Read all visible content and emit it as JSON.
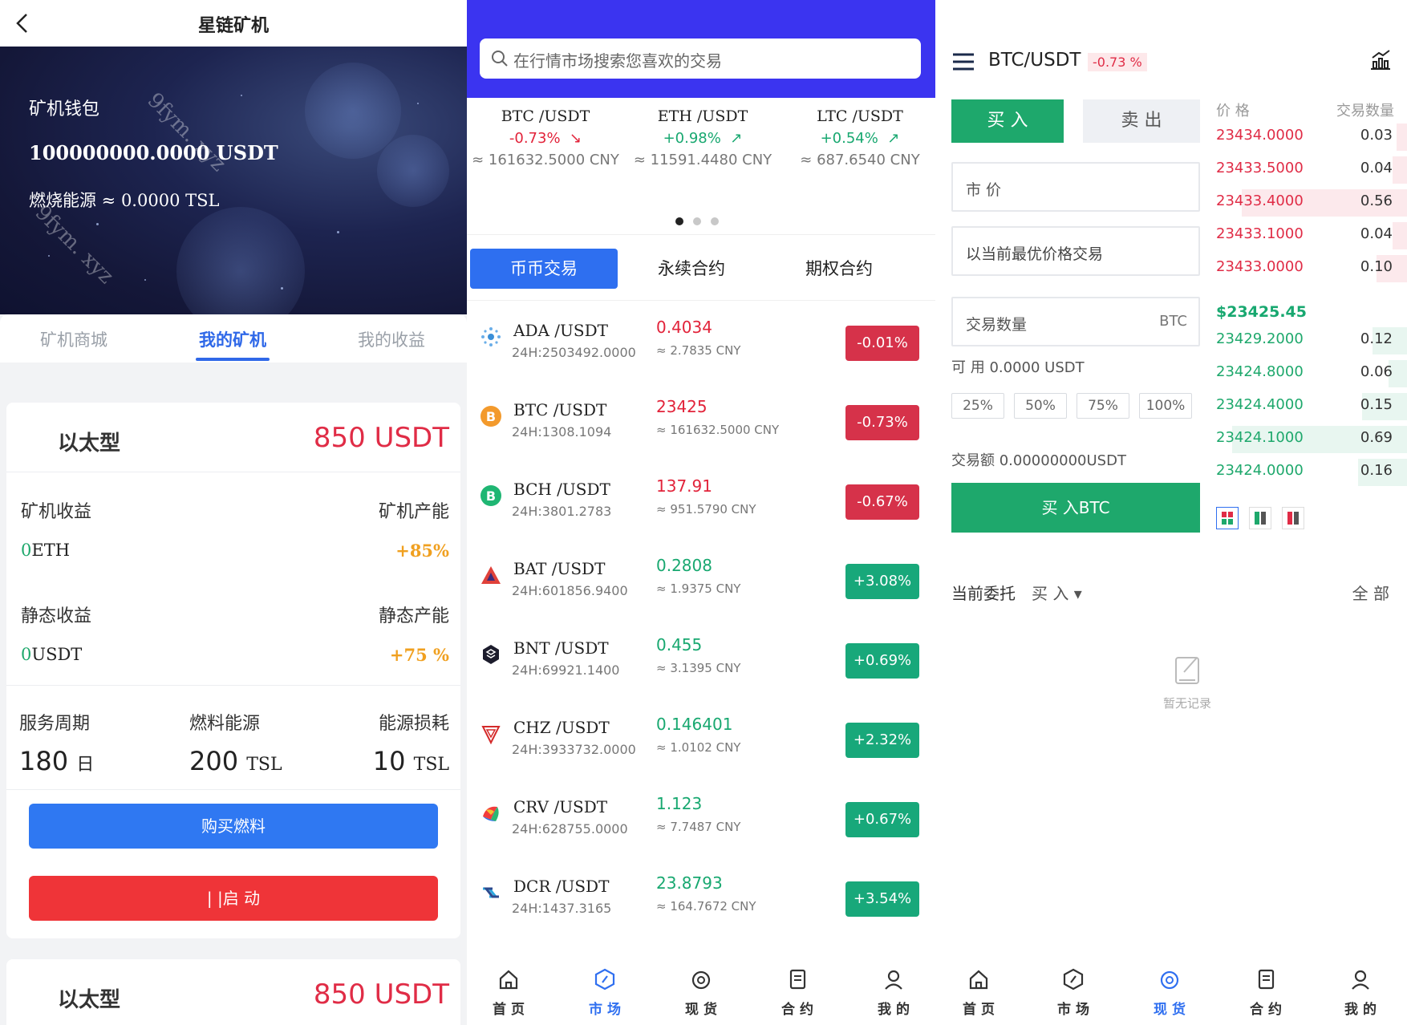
{
  "mining": {
    "title": "星链矿机",
    "banner": {
      "wallet_label": "矿机钱包",
      "balance": "100000000.0000 USDT",
      "fuel": "燃烧能源 ≈ 0.0000 TSL"
    },
    "tabs": [
      {
        "label": "矿机商城"
      },
      {
        "label": "我的矿机"
      },
      {
        "label": "我的收益"
      }
    ],
    "card": {
      "type": "以太型",
      "price": "850 USDT",
      "machine_income_label": "矿机收益",
      "machine_capacity_label": "矿机产能",
      "machine_income_num": "0",
      "machine_income_unit": "ETH",
      "machine_capacity": "+85%",
      "static_income_label": "静态收益",
      "static_capacity_label": "静态产能",
      "static_income_num": "0",
      "static_income_unit": "USDT",
      "static_capacity": "+75 %",
      "period_label": "服务周期",
      "fuel_label": "燃料能源",
      "loss_label": "能源损耗",
      "period_value": "180",
      "period_unit": "日",
      "fuel_value": "200",
      "fuel_unit": "TSL",
      "loss_value": "10",
      "loss_unit": "TSL",
      "buy_fuel": "购买燃料",
      "start": "| |启 动"
    },
    "card2": {
      "type": "以太型",
      "price": "850 USDT"
    },
    "watermark": "9fym. xyz"
  },
  "market": {
    "search_placeholder": "在行情市场搜索您喜欢的交易",
    "tickers": [
      {
        "pair": "BTC /USDT",
        "change": "-0.73%",
        "arrow": "↘",
        "cny": "≈ 161632.5000 CNY",
        "dir": "neg"
      },
      {
        "pair": "ETH /USDT",
        "change": "+0.98%",
        "arrow": "↗",
        "cny": "≈ 11591.4480 CNY",
        "dir": "pos"
      },
      {
        "pair": "LTC /USDT",
        "change": "+0.54%",
        "arrow": "↗",
        "cny": "≈ 687.6540 CNY",
        "dir": "pos"
      }
    ],
    "tabs": [
      {
        "label": "币币交易"
      },
      {
        "label": "永续合约"
      },
      {
        "label": "期权合约"
      }
    ],
    "rows": [
      {
        "icon": "ada-icon",
        "pair": "ADA /USDT",
        "vol": "24H:2503492.0000",
        "price": "0.4034",
        "cny": "≈ 2.7835 CNY",
        "change": "-0.01%",
        "dir": "neg"
      },
      {
        "icon": "btc-icon",
        "pair": "BTC /USDT",
        "vol": "24H:1308.1094",
        "price": "23425",
        "cny": "≈ 161632.5000 CNY",
        "change": "-0.73%",
        "dir": "neg"
      },
      {
        "icon": "bch-icon",
        "pair": "BCH /USDT",
        "vol": "24H:3801.2783",
        "price": "137.91",
        "cny": "≈ 951.5790 CNY",
        "change": "-0.67%",
        "dir": "neg"
      },
      {
        "icon": "bat-icon",
        "pair": "BAT /USDT",
        "vol": "24H:601856.9400",
        "price": "0.2808",
        "cny": "≈ 1.9375 CNY",
        "change": "+3.08%",
        "dir": "pos"
      },
      {
        "icon": "bnt-icon",
        "pair": "BNT /USDT",
        "vol": "24H:69921.1400",
        "price": "0.455",
        "cny": "≈ 3.1395 CNY",
        "change": "+0.69%",
        "dir": "pos"
      },
      {
        "icon": "chz-icon",
        "pair": "CHZ /USDT",
        "vol": "24H:3933732.0000",
        "price": "0.146401",
        "cny": "≈ 1.0102 CNY",
        "change": "+2.32%",
        "dir": "pos"
      },
      {
        "icon": "crv-icon",
        "pair": "CRV /USDT",
        "vol": "24H:628755.0000",
        "price": "1.123",
        "cny": "≈ 7.7487 CNY",
        "change": "+0.67%",
        "dir": "pos"
      },
      {
        "icon": "dcr-icon",
        "pair": "DCR /USDT",
        "vol": "24H:1437.3165",
        "price": "23.8793",
        "cny": "≈ 164.7672 CNY",
        "change": "+3.54%",
        "dir": "pos"
      }
    ],
    "nav": [
      {
        "label": "首 页",
        "icon": "home-icon"
      },
      {
        "label": "市 场",
        "icon": "market-icon"
      },
      {
        "label": "现 货",
        "icon": "spot-icon"
      },
      {
        "label": "合 约",
        "icon": "contract-icon"
      },
      {
        "label": "我 的",
        "icon": "profile-icon"
      }
    ]
  },
  "trade": {
    "pair": "BTC/USDT",
    "change": "-0.73 %",
    "buy_tab": "买 入",
    "sell_tab": "卖 出",
    "market_price": "市 价",
    "best_price": "以当前最优价格交易",
    "qty_placeholder": "交易数量",
    "qty_unit": "BTC",
    "available": "可 用 0.0000 USDT",
    "pct_buttons": [
      "25%",
      "50%",
      "75%",
      "100%"
    ],
    "amount": "交易额 0.00000000USDT",
    "buy_button": "买 入BTC",
    "orderbook": {
      "price_header": "价 格",
      "qty_header": "交易数量",
      "asks": [
        {
          "price": "23434.0000",
          "qty": "0.03",
          "depth": 0.05
        },
        {
          "price": "23433.5000",
          "qty": "0.04",
          "depth": 0.07
        },
        {
          "price": "23433.4000",
          "qty": "0.56",
          "depth": 0.81
        },
        {
          "price": "23433.1000",
          "qty": "0.04",
          "depth": 0.07
        },
        {
          "price": "23433.0000",
          "qty": "0.10",
          "depth": 0.15
        }
      ],
      "last_price": "$23425.45",
      "bids": [
        {
          "price": "23429.2000",
          "qty": "0.12",
          "depth": 0.17
        },
        {
          "price": "23424.8000",
          "qty": "0.06",
          "depth": 0.09
        },
        {
          "price": "23424.4000",
          "qty": "0.15",
          "depth": 0.22
        },
        {
          "price": "23424.1000",
          "qty": "0.69",
          "depth": 0.86
        },
        {
          "price": "23424.0000",
          "qty": "0.16",
          "depth": 0.24
        }
      ]
    },
    "orders_label": "当前委托",
    "orders_filter": "买 入 ▾",
    "orders_all": "全 部",
    "empty": "暂无记录",
    "colors": {
      "buy": "#1ea86c",
      "sell": "#e02c46"
    }
  }
}
